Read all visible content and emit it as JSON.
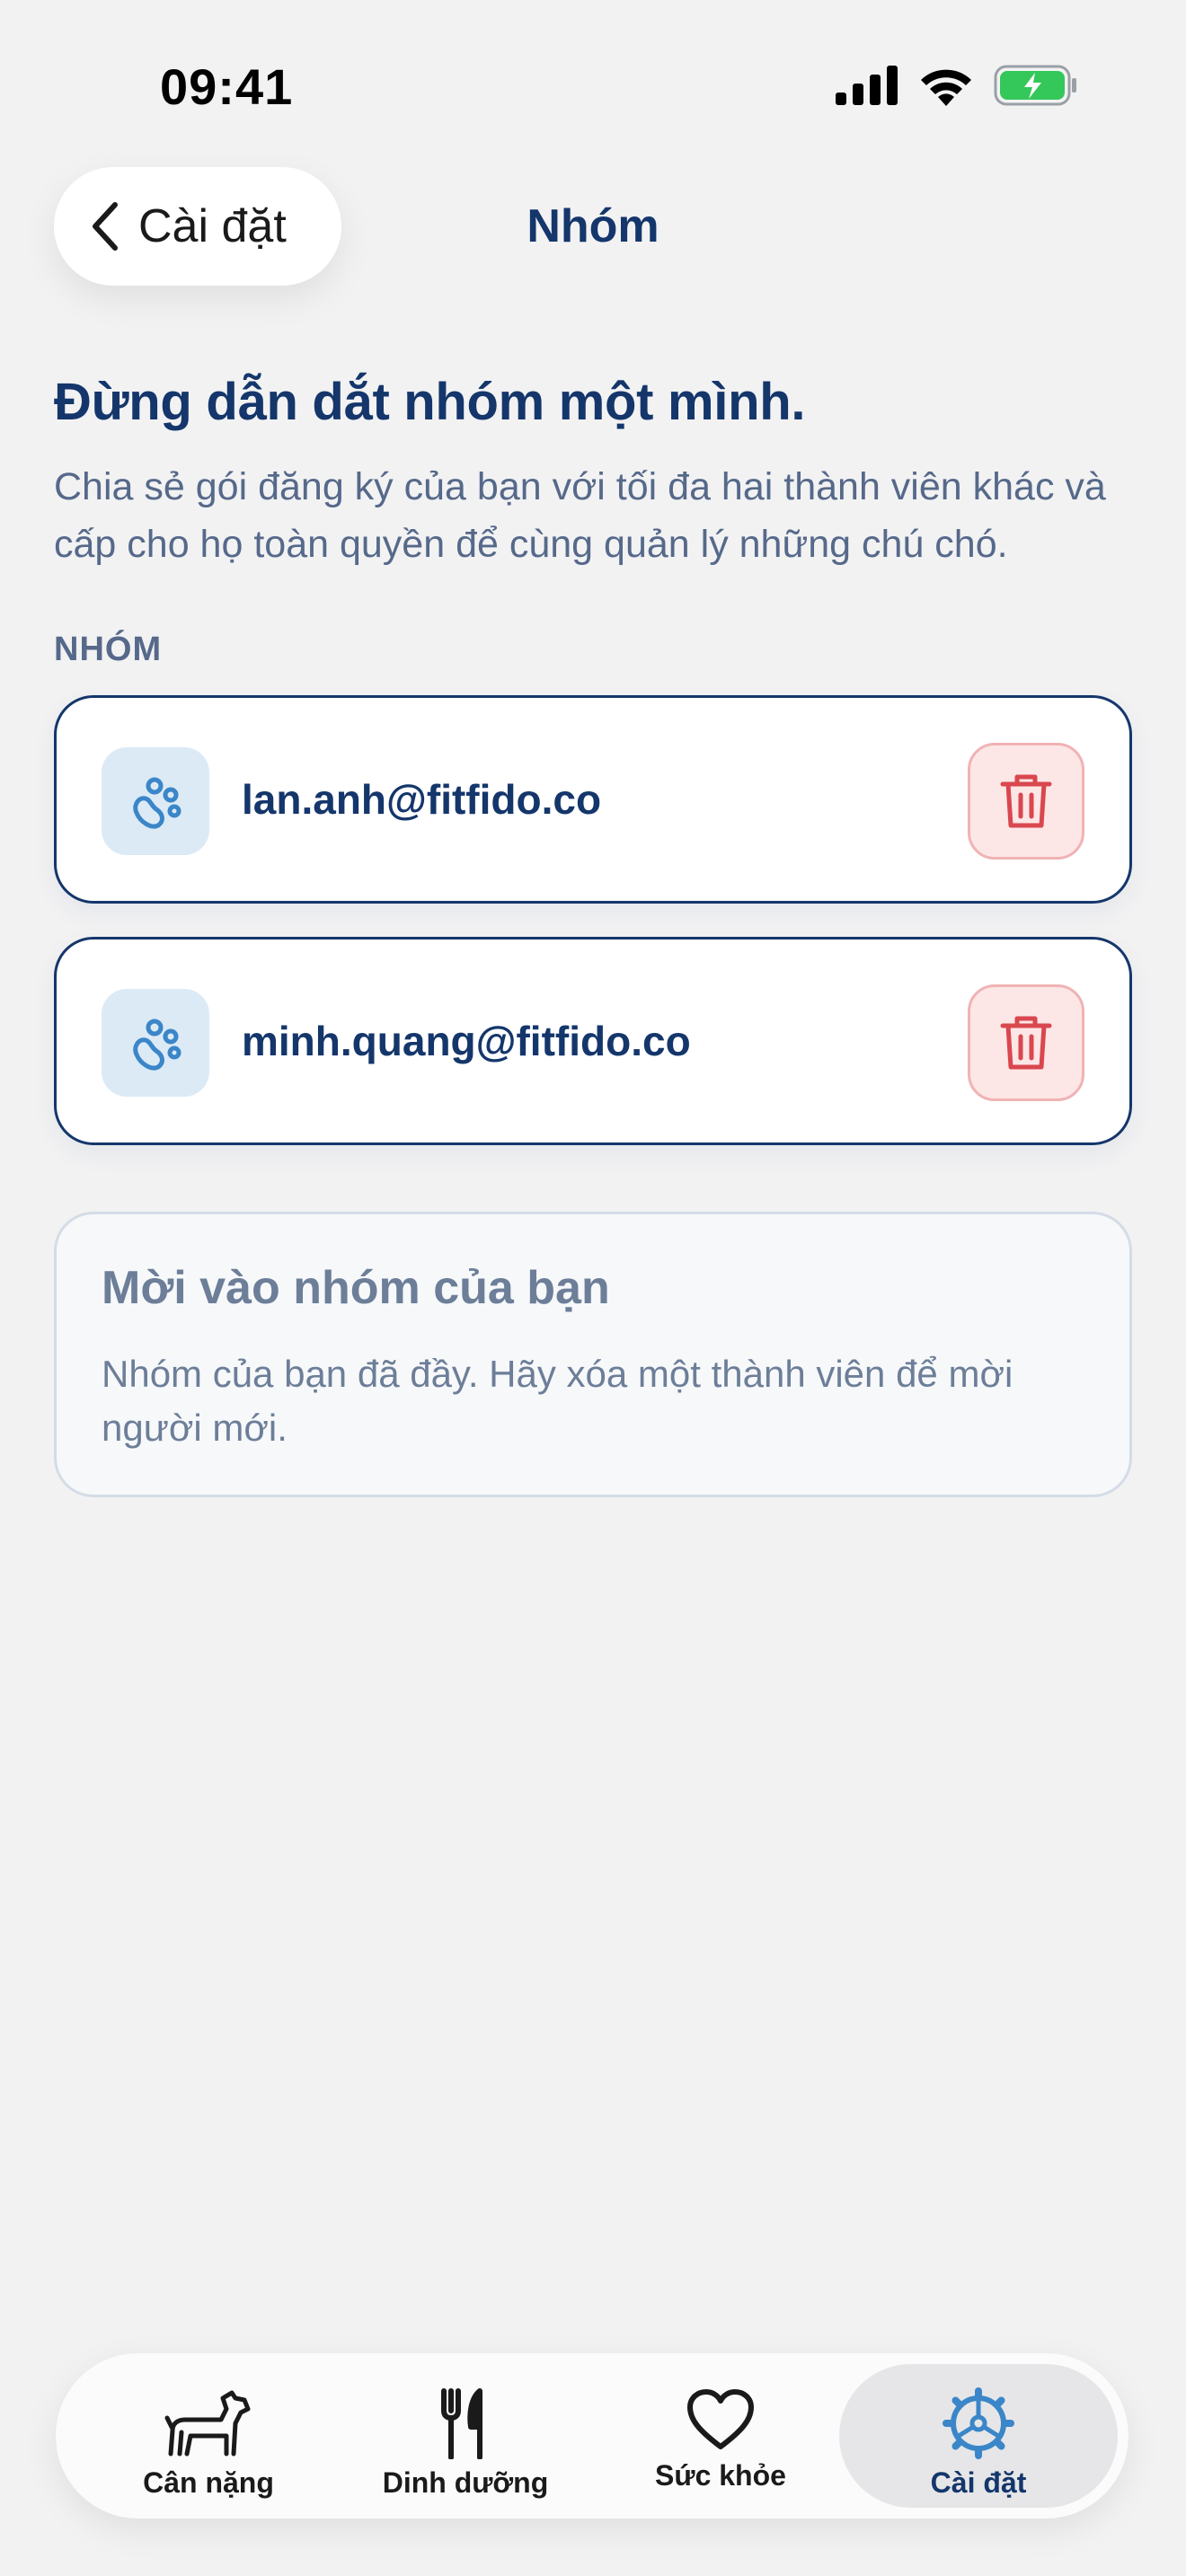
{
  "status_bar": {
    "time": "09:41"
  },
  "header": {
    "back_label": "Cài đặt",
    "title": "Nhóm"
  },
  "intro": {
    "headline": "Đừng dẫn dắt nhóm một mình.",
    "description": "Chia sẻ gói đăng ký của bạn với tối đa hai thành viên khác và cấp cho họ toàn quyền để cùng quản lý những chú chó."
  },
  "section_label": "NHÓM",
  "members": [
    {
      "email": "lan.anh@fitfido.co",
      "icon": "paw-icon"
    },
    {
      "email": "minh.quang@fitfido.co",
      "icon": "paw-icon"
    }
  ],
  "invite": {
    "title": "Mời vào nhóm của bạn",
    "text": "Nhóm của bạn đã đầy. Hãy xóa một thành viên để mời người mới."
  },
  "tabs": [
    {
      "label": "Cân nặng",
      "icon": "dog-icon",
      "active": false
    },
    {
      "label": "Dinh dưỡng",
      "icon": "fork-knife-icon",
      "active": false
    },
    {
      "label": "Sức khỏe",
      "icon": "heart-icon",
      "active": false
    },
    {
      "label": "Cài đặt",
      "icon": "settings-gear-icon",
      "active": true
    }
  ],
  "colors": {
    "primary": "#14366b",
    "accent": "#3a86c8",
    "danger": "#d9474f",
    "background": "#f2f2f3"
  }
}
